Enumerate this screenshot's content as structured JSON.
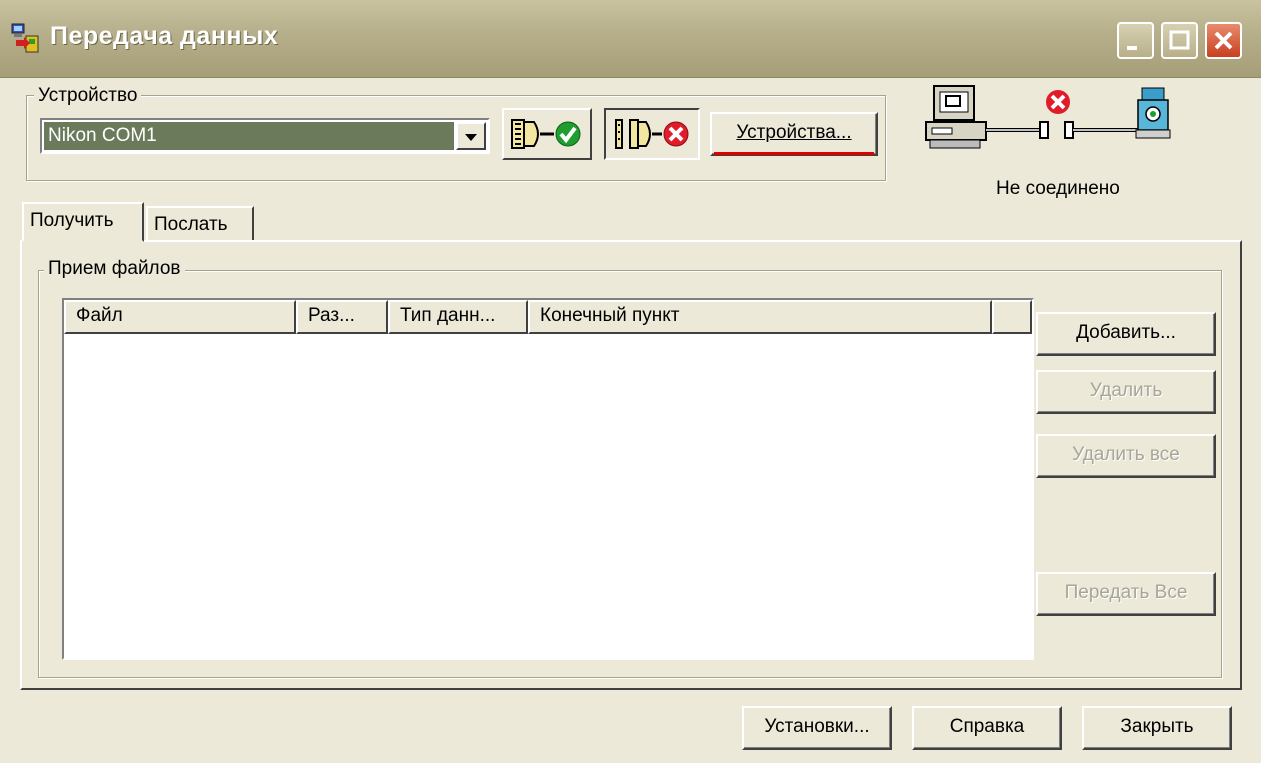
{
  "window": {
    "title": "Передача данных"
  },
  "device_group": {
    "label": "Устройство",
    "selected_device": "Nikon COM1",
    "devices_button": "Устройства..."
  },
  "connection": {
    "status": "Не соединено"
  },
  "tabs": [
    {
      "label": "Получить",
      "active": true
    },
    {
      "label": "Послать",
      "active": false
    }
  ],
  "receive_group": {
    "label": "Прием файлов",
    "columns": [
      "Файл",
      "Раз...",
      "Тип данн...",
      "Конечный пункт",
      ""
    ],
    "rows": []
  },
  "side_buttons": {
    "add": "Добавить...",
    "delete": "Удалить",
    "delete_all": "Удалить все",
    "transfer_all": "Передать Все"
  },
  "footer": {
    "settings": "Установки...",
    "help": "Справка",
    "close": "Закрыть"
  },
  "colors": {
    "background": "#ECE9D8",
    "combo_selection": "#6B7A5A",
    "connect_ok": "#1E9E2E",
    "disconnect": "#E01B2A",
    "underline_accent": "#E00000"
  },
  "icons": [
    "app-transfer-icon",
    "connect-icon",
    "disconnect-icon",
    "computer-icon",
    "error-icon",
    "cable-icon",
    "total-station-icon"
  ]
}
